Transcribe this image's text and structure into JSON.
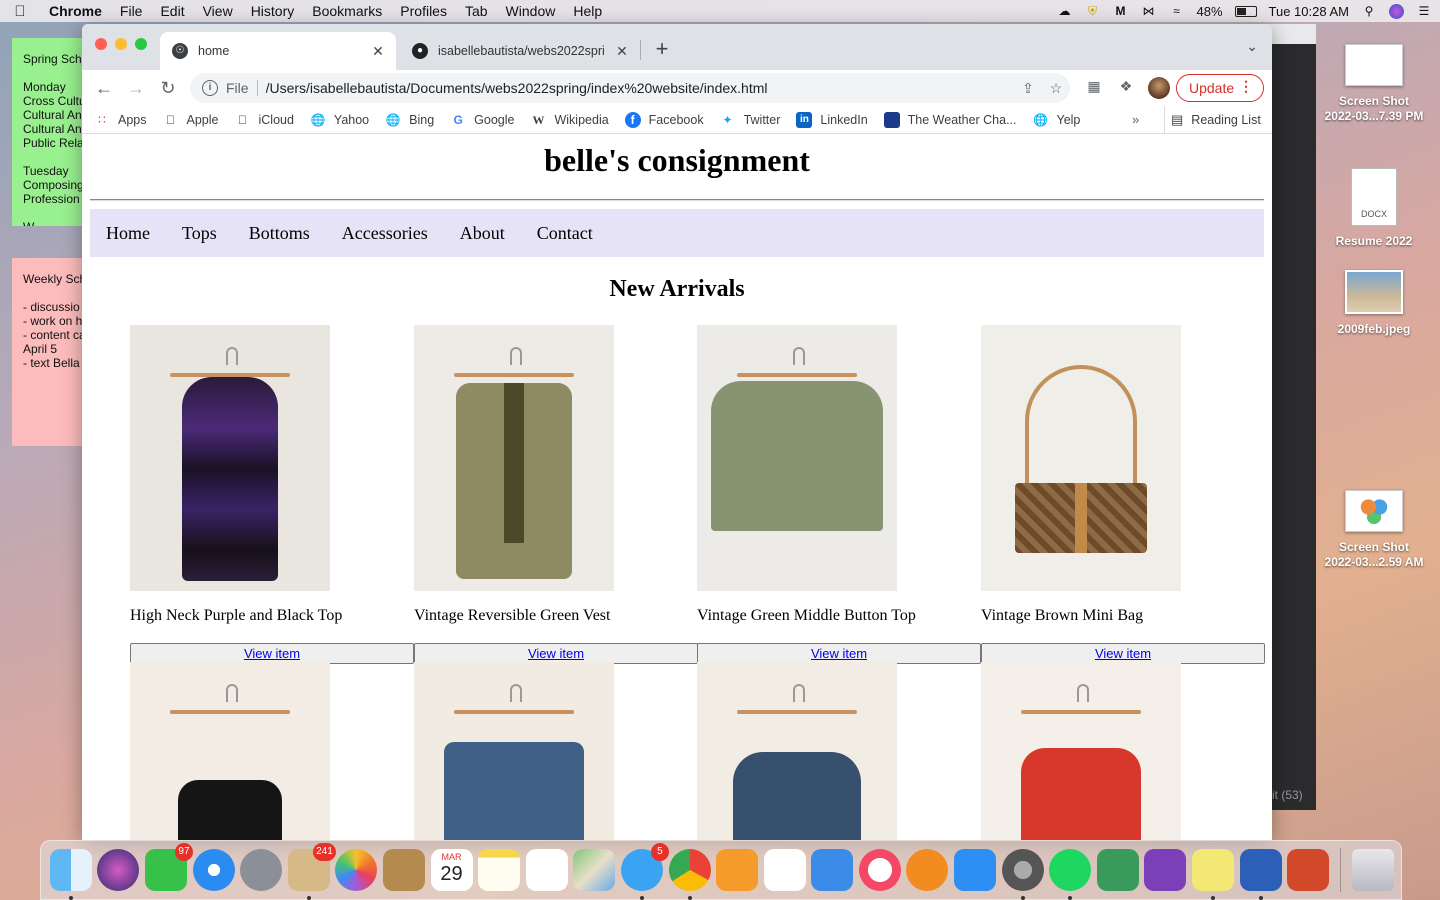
{
  "menubar": {
    "app_name": "Chrome",
    "menus": [
      "File",
      "Edit",
      "View",
      "History",
      "Bookmarks",
      "Profiles",
      "Tab",
      "Window",
      "Help"
    ],
    "battery": "48%",
    "clock": "Tue 10:28 AM"
  },
  "sticky_green": {
    "lines": [
      "Spring Sch",
      "",
      "Monday",
      "Cross Cultu",
      "Cultural An",
      "Cultural An",
      "Public Rela",
      "",
      "Tuesday",
      "Composing",
      "Profession",
      "",
      "W"
    ]
  },
  "sticky_pink": {
    "lines": [
      "Weekly Sch",
      "",
      "- discussio",
      "- work on h",
      "- content ca",
      "April 5",
      "- text Bella"
    ]
  },
  "desktop": {
    "icons": [
      {
        "label_line1": "Screen Shot",
        "label_line2": "2022-03...7.39 PM"
      },
      {
        "label_line1": "Resume 2022",
        "label_line2": "",
        "doc_label": "DOCX"
      },
      {
        "label_line1": "2009feb.jpeg",
        "label_line2": ""
      },
      {
        "label_line1": "Screen Shot",
        "label_line2": "2022-03...2.59 AM"
      }
    ],
    "bg_window_count": "it (53)"
  },
  "browser": {
    "tabs": [
      {
        "title": "home"
      },
      {
        "title": "isabellebautista/webs2022spri"
      }
    ],
    "omnibox": {
      "scheme": "File",
      "url": "/Users/isabellebautista/Documents/webs2022spring/index%20website/index.html"
    },
    "update_label": "Update",
    "bookmarks": [
      "Apps",
      "Apple",
      "iCloud",
      "Yahoo",
      "Bing",
      "Google",
      "Wikipedia",
      "Facebook",
      "Twitter",
      "LinkedIn",
      "The Weather Cha...",
      "Yelp"
    ],
    "reading_list": "Reading List"
  },
  "page": {
    "site_title": "belle's consignment",
    "nav": [
      "Home",
      "Tops",
      "Bottoms",
      "Accessories",
      "About",
      "Contact"
    ],
    "section_title": "New Arrivals",
    "view_label": "View item",
    "products": [
      {
        "name": "High Neck Purple and Black Top"
      },
      {
        "name": "Vintage Reversible Green Vest"
      },
      {
        "name": "Vintage Green Middle Button Top"
      },
      {
        "name": "Vintage Brown Mini Bag"
      }
    ]
  },
  "dock": {
    "badges": {
      "facetime": "97",
      "mail": "241",
      "calendar_month": "MAR",
      "calendar_day": "29",
      "messages": "5"
    }
  },
  "colors": {
    "nav_bg": "#e6e3f7",
    "update_red": "#d93025",
    "sticky_green": "#99f08f",
    "sticky_pink": "#fdbcbc"
  }
}
